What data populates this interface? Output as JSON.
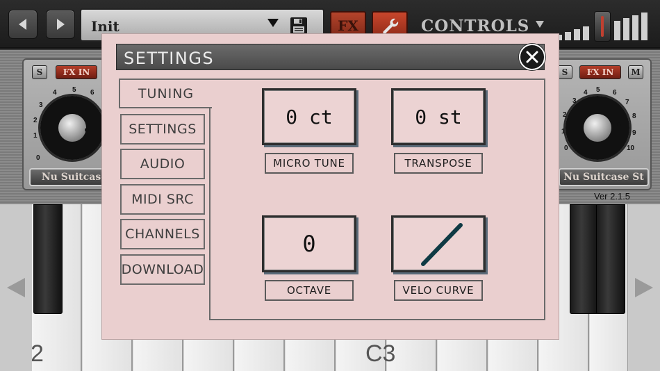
{
  "toolbar": {
    "preset_name": "Init",
    "fx_label": "FX",
    "controls_label": "CONTROLS"
  },
  "modules": {
    "left": {
      "solo": "S",
      "fx_in": "FX IN",
      "name": "Nu Suitcase"
    },
    "right": {
      "solo": "S",
      "fx_in": "FX IN",
      "mute": "M",
      "name": "Nu Suitcase St"
    },
    "knob_scale_left": [
      "0",
      "1",
      "2",
      "3",
      "4",
      "5",
      "6"
    ],
    "knob_scale_right": [
      "0",
      "1",
      "2",
      "3",
      "4",
      "5",
      "6",
      "7",
      "8",
      "9",
      "10"
    ]
  },
  "version": "Ver 2.1.5",
  "keyboard": {
    "label_left": "2",
    "label_c3": "C3"
  },
  "dialog": {
    "title": "SETTINGS",
    "tabs": [
      {
        "label": "TUNING",
        "active": true
      },
      {
        "label": "SETTINGS"
      },
      {
        "label": "AUDIO"
      },
      {
        "label": "MIDI SRC"
      },
      {
        "label": "CHANNELS"
      },
      {
        "label": "DOWNLOAD"
      }
    ],
    "params": {
      "micro_tune": {
        "value": "0 ct",
        "label": "MICRO TUNE"
      },
      "transpose": {
        "value": "0 st",
        "label": "TRANSPOSE"
      },
      "octave": {
        "value": "0",
        "label": "OCTAVE"
      },
      "velo_curve": {
        "label": "VELO CURVE",
        "curve": "linear"
      }
    }
  },
  "colors": {
    "dialog_bg": "#eacfcf",
    "header_bg": "#5a5a5a",
    "accent_red": "#b33d29",
    "curve_color": "#0f3a44"
  }
}
